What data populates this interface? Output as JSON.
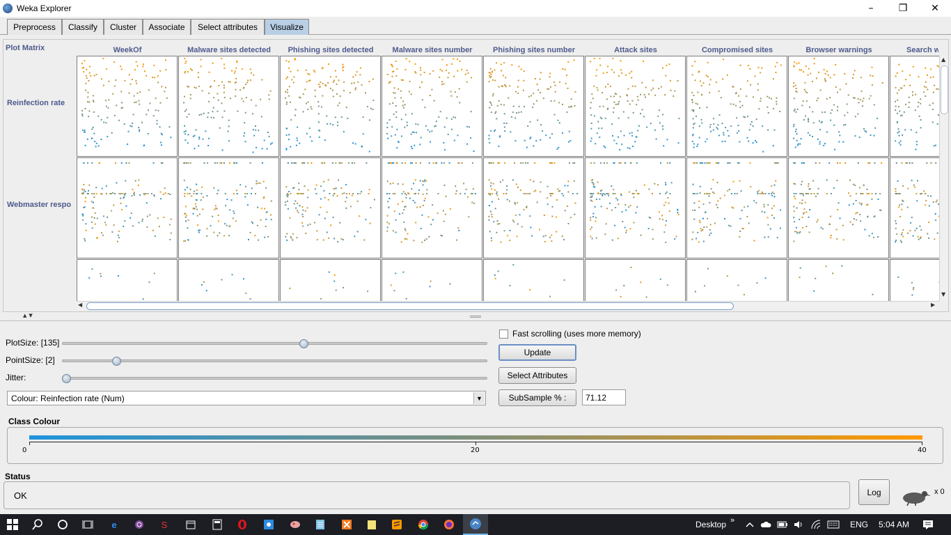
{
  "window": {
    "title": "Weka Explorer",
    "controls": [
      "–",
      "❐",
      "✕"
    ]
  },
  "tabs": [
    {
      "label": "Preprocess",
      "active": false
    },
    {
      "label": "Classify",
      "active": false
    },
    {
      "label": "Cluster",
      "active": false
    },
    {
      "label": "Associate",
      "active": false
    },
    {
      "label": "Select attributes",
      "active": false
    },
    {
      "label": "Visualize",
      "active": true
    }
  ],
  "matrix": {
    "label": "Plot Matrix",
    "columns": [
      "WeekOf",
      "Malware sites detected",
      "Phishing sites detected",
      "Malware sites number",
      "Phishing sites number",
      "Attack sites",
      "Compromised sites",
      "Browser warnings",
      "Search w"
    ],
    "rows": [
      "Reinfection rate",
      "Webmaster respo"
    ],
    "colors": {
      "low": "#1f94dc",
      "high": "#ff9900",
      "mid": "#7f8f7a"
    }
  },
  "controls": {
    "plotsize_label": "PlotSize: [135]",
    "pointsize_label": "PointSize: [2]",
    "jitter_label": "Jitter:",
    "plotsize_value": 0.57,
    "pointsize_value": 0.12,
    "jitter_value": 0.0,
    "colour_select": "Colour: Reinfection rate  (Num)",
    "fast_scrolling_label": "Fast scrolling (uses more memory)",
    "update_button": "Update",
    "select_attributes_button": "Select Attributes",
    "subsample_button": "SubSample % :",
    "subsample_value": "71.12"
  },
  "class_colour": {
    "title": "Class Colour",
    "ticks": [
      "0",
      "20",
      "40"
    ],
    "gradient_start": "#1f94dc",
    "gradient_end": "#ff9900"
  },
  "status": {
    "title": "Status",
    "text": "OK",
    "log_button": "Log",
    "task_count": "x 0"
  },
  "taskbar": {
    "desktop_label": "Desktop",
    "language": "ENG",
    "time": "5:04 AM"
  }
}
